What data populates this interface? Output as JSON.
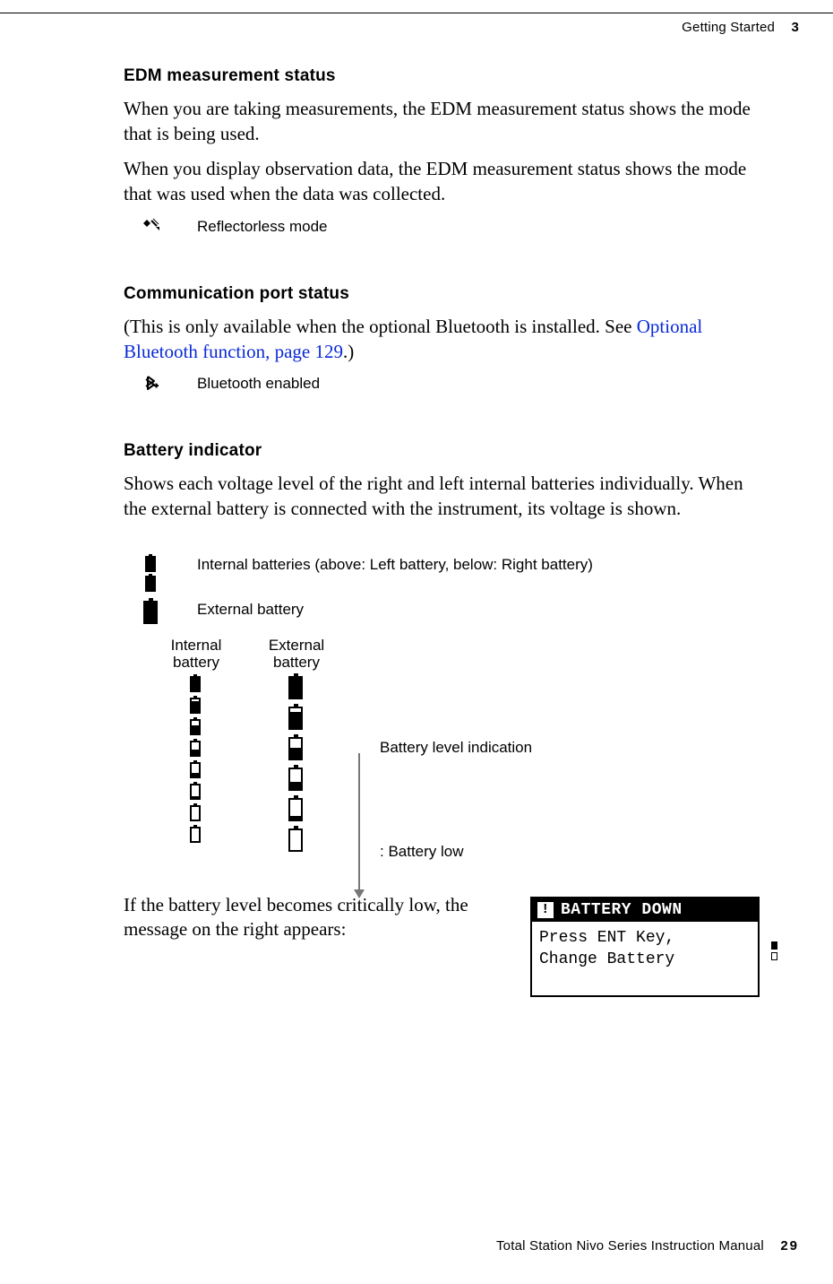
{
  "header": {
    "chapter": "Getting Started",
    "section_num": "3"
  },
  "s1": {
    "title": "EDM measurement status",
    "p1": "When you are taking measurements, the EDM measurement status shows the mode that is being used.",
    "p2": "When you display observation data, the EDM measurement status shows the mode that was used when the data was collected.",
    "icon1_label": "Reflectorless mode"
  },
  "s2": {
    "title": "Communication port status",
    "p1_pre": "(This is only available when the optional Bluetooth is installed. See ",
    "p1_link": "Optional Bluetooth function, page 129",
    "p1_post": ".)",
    "icon1_label": "Bluetooth enabled"
  },
  "s3": {
    "title": "Battery indicator",
    "p1": "Shows each voltage level of the right and left internal batteries individually. When the external battery is connected with the instrument, its voltage is shown.",
    "icon1_label": "Internal batteries (above: Left battery, below: Right battery)",
    "icon2_label": "External battery",
    "col1_l1": "Internal",
    "col1_l2": "battery",
    "col2_l1": "External",
    "col2_l2": "battery",
    "note1": "Battery level indication",
    "note2": ": Battery low",
    "p2": "If the battery level becomes critically low, the message on the right appears:"
  },
  "lcd": {
    "title": "BATTERY DOWN",
    "line1": "Press ENT Key,",
    "line2": " Change Battery"
  },
  "footer": {
    "title": "Total Station Nivo Series Instruction Manual",
    "page": "29"
  }
}
